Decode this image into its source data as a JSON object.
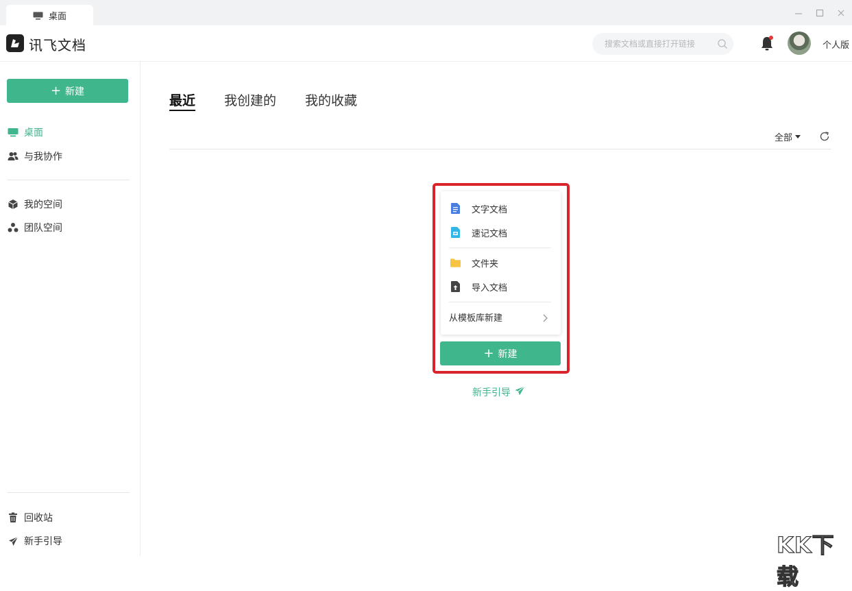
{
  "window": {
    "tab_label": "桌面"
  },
  "header": {
    "brand": "讯飞文档",
    "search_placeholder": "搜索文档或直接打开链接",
    "edition": "个人版"
  },
  "sidebar": {
    "new_button": "新建",
    "items": [
      {
        "label": "桌面",
        "icon": "desktop-icon"
      },
      {
        "label": "与我协作",
        "icon": "users-icon"
      },
      {
        "label": "我的空间",
        "icon": "cube-icon"
      },
      {
        "label": "团队空间",
        "icon": "team-icon"
      }
    ],
    "bottom": [
      {
        "label": "回收站",
        "icon": "trash-icon"
      },
      {
        "label": "新手引导",
        "icon": "send-icon"
      }
    ]
  },
  "main": {
    "tabs": [
      {
        "label": "最近"
      },
      {
        "label": "我创建的"
      },
      {
        "label": "我的收藏"
      }
    ],
    "filter": "全部"
  },
  "new_menu": {
    "items": [
      {
        "label": "文字文档",
        "icon": "text-doc-icon"
      },
      {
        "label": "速记文档",
        "icon": "shorthand-doc-icon"
      },
      {
        "label": "文件夹",
        "icon": "folder-icon"
      },
      {
        "label": "导入文档",
        "icon": "import-icon"
      },
      {
        "label": "从模板库新建",
        "icon": "chevron-right-icon"
      }
    ],
    "new_button": "新建",
    "guide_link": "新手引导"
  },
  "watermark": "KK下载",
  "colors": {
    "accent": "#3fb68b",
    "highlight": "#d9242b"
  }
}
